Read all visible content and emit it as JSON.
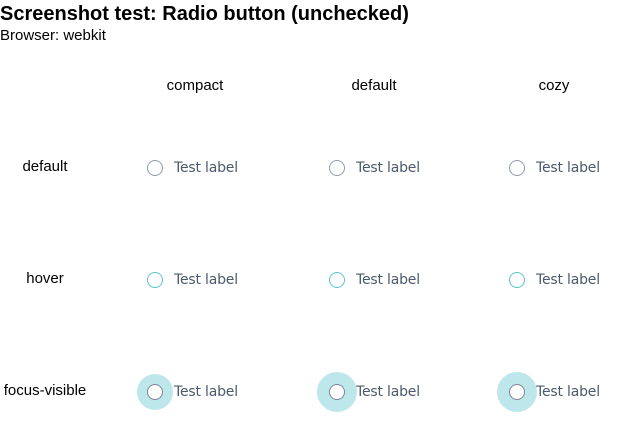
{
  "title": "Screenshot test: Radio button (unchecked)",
  "browser_info": "Browser: webkit",
  "columns": [
    "compact",
    "default",
    "cozy"
  ],
  "rows": [
    "default",
    "hover",
    "focus-visible"
  ],
  "radio_label": "Test label",
  "radio_checked": false,
  "colors": {
    "radio_border": "#8e9bad",
    "hover_border": "#5ac4d0",
    "focus_ring": "#bde7eb",
    "label_text": "#4b5b6b"
  }
}
